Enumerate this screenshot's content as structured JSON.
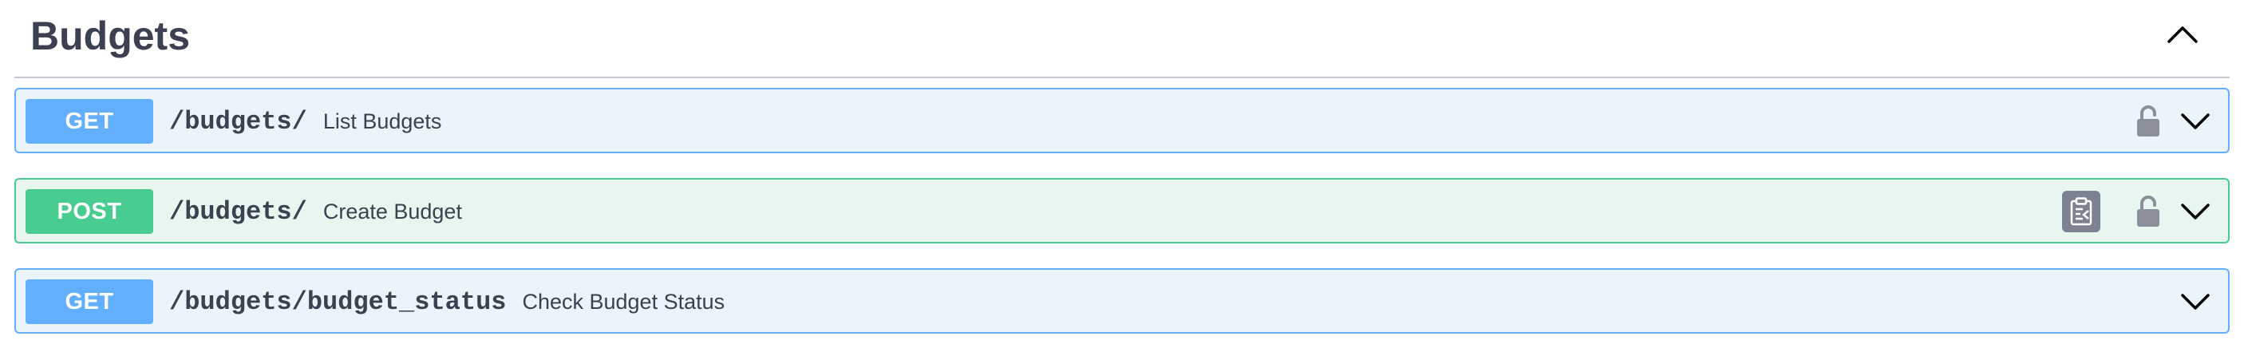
{
  "section": {
    "title": "Budgets",
    "toggle_icon": "chevron-up-icon"
  },
  "operations": [
    {
      "method": "GET",
      "path": "/budgets/",
      "summary": "List Budgets",
      "color": "#61affe",
      "locked": true
    },
    {
      "method": "POST",
      "path": "/budgets/",
      "summary": "Create Budget",
      "color": "#49cc90",
      "locked": true,
      "copy_icon": "clipboard-icon"
    },
    {
      "method": "GET",
      "path": "/budgets/budget_status",
      "summary": "Check Budget Status",
      "color": "#61affe",
      "locked": false
    }
  ],
  "icons": {
    "lock": "lock-icon",
    "expand": "chevron-down-icon"
  }
}
